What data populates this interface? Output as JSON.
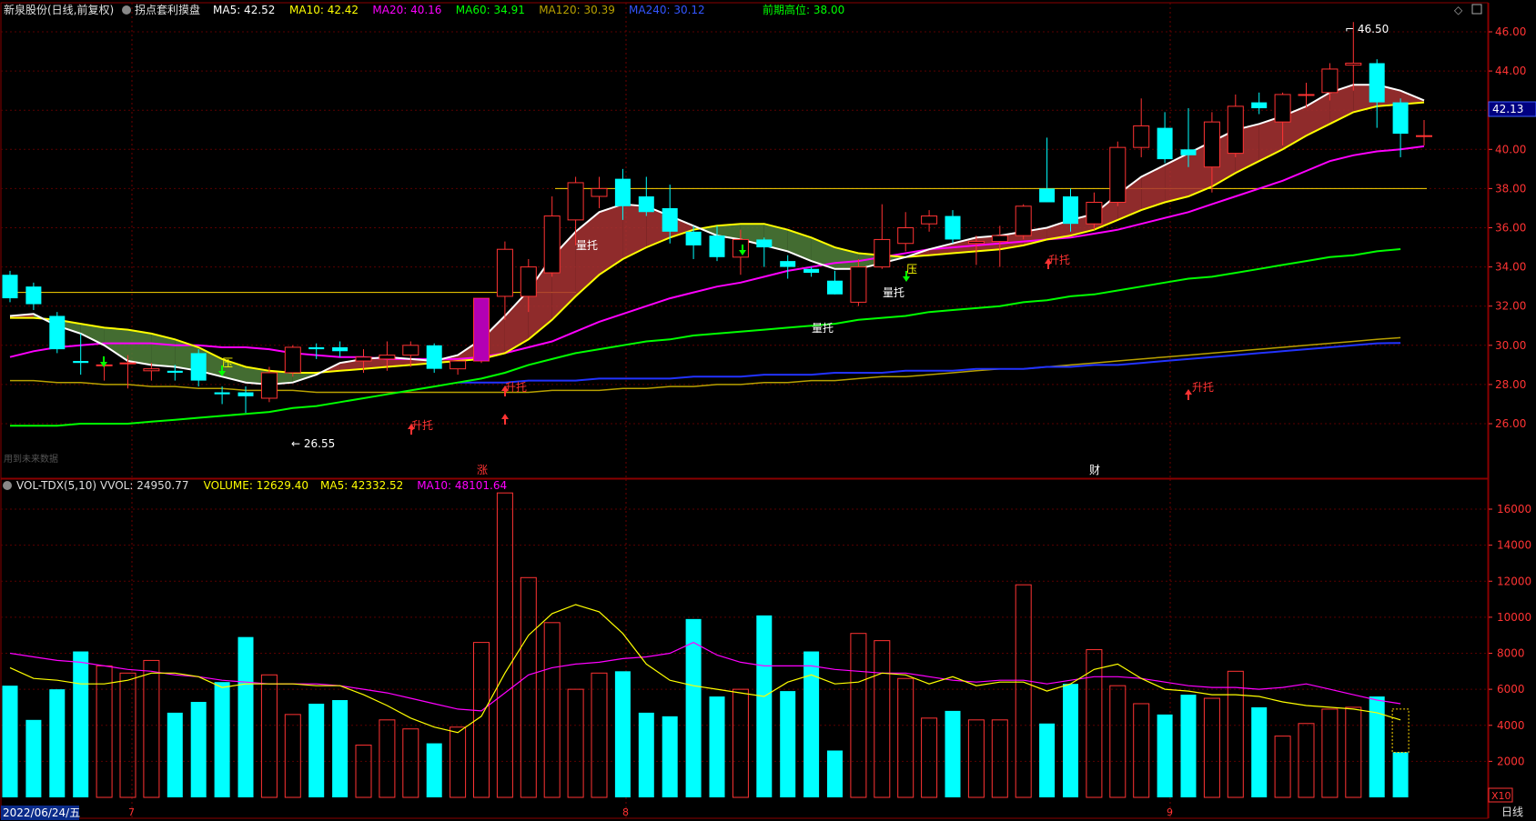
{
  "header": {
    "title": "新泉股份(日线,前复权)",
    "indicator_name": "拐点套利摸盘",
    "ma_items": [
      {
        "label": "MA5: 42.52",
        "color": "#ffffff"
      },
      {
        "label": "MA10: 42.42",
        "color": "#ffff00"
      },
      {
        "label": "MA20: 40.16",
        "color": "#ff00ff"
      },
      {
        "label": "MA60: 34.91",
        "color": "#00ff00"
      },
      {
        "label": "MA120: 30.39",
        "color": "#b8a000"
      },
      {
        "label": "MA240: 30.12",
        "color": "#3355ff"
      }
    ],
    "prev_high_label": "前期高位: 38.00"
  },
  "volume_header": {
    "name": "VOL-TDX(5,10)",
    "items": [
      {
        "label": "VVOL: 24950.77",
        "color": "#dddddd"
      },
      {
        "label": "VOLUME: 12629.40",
        "color": "#ffff00"
      },
      {
        "label": "MA5: 42332.52",
        "color": "#ffff00"
      },
      {
        "label": "MA10: 48101.64",
        "color": "#ff00ff"
      }
    ]
  },
  "price_axis_ticks": [
    "46.00",
    "44.00",
    "42.00",
    "40.00",
    "38.00",
    "36.00",
    "34.00",
    "32.00",
    "30.00",
    "28.00",
    "26.00"
  ],
  "volume_axis_ticks": [
    "16000",
    "14000",
    "12000",
    "10000",
    "8000",
    "6000",
    "4000",
    "2000"
  ],
  "current_price": "42.13",
  "volume_unit": "X10",
  "date_label": "2022/06/24/五",
  "month_labels": [
    "7",
    "8",
    "9"
  ],
  "period_label": "日线",
  "annotations": {
    "high": "46.50",
    "low": "26.55",
    "hold": "量托",
    "press": "压",
    "rise_hold": "升托",
    "surge": "涨",
    "finance": "财",
    "faint": "用到未来数据"
  },
  "colors": {
    "up": "#ff3333",
    "down": "#00ffff",
    "grid": "#5a0000",
    "bg": "#000000"
  },
  "chart_data": {
    "type": "candlestick",
    "candles": [
      {
        "o": 33.6,
        "h": 33.8,
        "l": 32.2,
        "c": 32.4
      },
      {
        "o": 33.0,
        "h": 33.2,
        "l": 31.8,
        "c": 32.1
      },
      {
        "o": 31.5,
        "h": 31.7,
        "l": 29.6,
        "c": 29.8
      },
      {
        "o": 29.2,
        "h": 30.6,
        "l": 28.5,
        "c": 29.1
      },
      {
        "o": 29.0,
        "h": 29.2,
        "l": 28.2,
        "c": 29.0
      },
      {
        "o": 29.1,
        "h": 29.5,
        "l": 27.8,
        "c": 29.1
      },
      {
        "o": 28.7,
        "h": 29.1,
        "l": 28.2,
        "c": 28.8
      },
      {
        "o": 28.7,
        "h": 29.0,
        "l": 28.2,
        "c": 28.6
      },
      {
        "o": 29.6,
        "h": 29.8,
        "l": 27.9,
        "c": 28.2
      },
      {
        "o": 27.6,
        "h": 27.9,
        "l": 27.0,
        "c": 27.5
      },
      {
        "o": 27.6,
        "h": 27.9,
        "l": 26.55,
        "c": 27.4
      },
      {
        "o": 27.3,
        "h": 28.9,
        "l": 27.1,
        "c": 28.6
      },
      {
        "o": 28.6,
        "h": 30.0,
        "l": 28.4,
        "c": 29.9
      },
      {
        "o": 29.9,
        "h": 30.1,
        "l": 29.3,
        "c": 29.8
      },
      {
        "o": 29.9,
        "h": 30.2,
        "l": 29.4,
        "c": 29.7
      },
      {
        "o": 29.2,
        "h": 29.8,
        "l": 28.6,
        "c": 29.4
      },
      {
        "o": 29.3,
        "h": 30.2,
        "l": 28.7,
        "c": 29.5
      },
      {
        "o": 29.5,
        "h": 30.2,
        "l": 28.9,
        "c": 30.0
      },
      {
        "o": 30.0,
        "h": 30.1,
        "l": 28.6,
        "c": 28.8
      },
      {
        "o": 28.8,
        "h": 29.2,
        "l": 28.5,
        "c": 29.2
      },
      {
        "o": 29.2,
        "h": 32.4,
        "l": 29.1,
        "c": 32.4
      },
      {
        "o": 32.5,
        "h": 35.3,
        "l": 31.3,
        "c": 34.9
      },
      {
        "o": 32.5,
        "h": 34.4,
        "l": 31.7,
        "c": 34.0
      },
      {
        "o": 33.7,
        "h": 37.6,
        "l": 33.5,
        "c": 36.6
      },
      {
        "o": 36.4,
        "h": 38.6,
        "l": 35.1,
        "c": 38.3
      },
      {
        "o": 37.6,
        "h": 38.6,
        "l": 37.0,
        "c": 38.0
      },
      {
        "o": 38.5,
        "h": 39.0,
        "l": 36.4,
        "c": 37.1
      },
      {
        "o": 37.6,
        "h": 38.6,
        "l": 36.6,
        "c": 36.8
      },
      {
        "o": 37.0,
        "h": 38.2,
        "l": 35.2,
        "c": 35.8
      },
      {
        "o": 35.8,
        "h": 36.1,
        "l": 34.4,
        "c": 35.1
      },
      {
        "o": 35.6,
        "h": 36.1,
        "l": 34.3,
        "c": 34.5
      },
      {
        "o": 34.5,
        "h": 35.9,
        "l": 33.6,
        "c": 35.4
      },
      {
        "o": 35.4,
        "h": 35.5,
        "l": 34.0,
        "c": 35.0
      },
      {
        "o": 34.3,
        "h": 34.6,
        "l": 33.4,
        "c": 34.0
      },
      {
        "o": 33.9,
        "h": 34.0,
        "l": 33.5,
        "c": 33.7
      },
      {
        "o": 33.3,
        "h": 33.8,
        "l": 32.6,
        "c": 32.6
      },
      {
        "o": 32.2,
        "h": 34.4,
        "l": 32.0,
        "c": 34.0
      },
      {
        "o": 34.0,
        "h": 37.2,
        "l": 33.9,
        "c": 35.4
      },
      {
        "o": 35.2,
        "h": 36.8,
        "l": 34.8,
        "c": 36.0
      },
      {
        "o": 36.2,
        "h": 36.9,
        "l": 35.8,
        "c": 36.6
      },
      {
        "o": 36.6,
        "h": 36.9,
        "l": 35.2,
        "c": 35.4
      },
      {
        "o": 35.2,
        "h": 35.6,
        "l": 34.1,
        "c": 35.3
      },
      {
        "o": 35.3,
        "h": 36.1,
        "l": 34.0,
        "c": 35.6
      },
      {
        "o": 35.6,
        "h": 37.2,
        "l": 35.4,
        "c": 37.1
      },
      {
        "o": 38.0,
        "h": 40.6,
        "l": 37.3,
        "c": 37.3
      },
      {
        "o": 37.6,
        "h": 38.0,
        "l": 35.8,
        "c": 36.2
      },
      {
        "o": 36.2,
        "h": 37.8,
        "l": 35.9,
        "c": 37.3
      },
      {
        "o": 37.3,
        "h": 40.4,
        "l": 37.1,
        "c": 40.1
      },
      {
        "o": 40.1,
        "h": 42.6,
        "l": 39.6,
        "c": 41.2
      },
      {
        "o": 41.1,
        "h": 41.9,
        "l": 39.3,
        "c": 39.5
      },
      {
        "o": 40.0,
        "h": 42.1,
        "l": 39.1,
        "c": 39.7
      },
      {
        "o": 39.1,
        "h": 41.9,
        "l": 37.8,
        "c": 41.4
      },
      {
        "o": 39.8,
        "h": 42.8,
        "l": 39.6,
        "c": 42.2
      },
      {
        "o": 42.4,
        "h": 42.9,
        "l": 41.8,
        "c": 42.1
      },
      {
        "o": 41.4,
        "h": 42.9,
        "l": 40.2,
        "c": 42.8
      },
      {
        "o": 42.8,
        "h": 43.4,
        "l": 42.1,
        "c": 42.8
      },
      {
        "o": 42.9,
        "h": 44.4,
        "l": 42.5,
        "c": 44.1
      },
      {
        "o": 44.3,
        "h": 46.5,
        "l": 43.0,
        "c": 44.4
      },
      {
        "o": 44.4,
        "h": 44.6,
        "l": 41.1,
        "c": 42.4
      },
      {
        "o": 42.4,
        "h": 42.6,
        "l": 39.6,
        "c": 40.8
      },
      {
        "o": 40.7,
        "h": 41.5,
        "l": 40.2,
        "c": 40.7
      }
    ],
    "volume": [
      6200,
      4300,
      6000,
      8100,
      7300,
      6900,
      7600,
      4700,
      5300,
      6400,
      8900,
      6800,
      4600,
      5200,
      5400,
      2900,
      4300,
      3800,
      3000,
      3900,
      8600,
      16900,
      12200,
      9700,
      6000,
      6900,
      7000,
      4700,
      4500,
      9900,
      5600,
      6000,
      10100,
      5900,
      8100,
      2600,
      9100,
      8700,
      6600,
      4400,
      4800,
      4300,
      4300,
      11800,
      4100,
      6300,
      8200,
      6200,
      5200,
      4600,
      5700,
      5500,
      7000,
      5000,
      3400,
      4100,
      4900,
      5000,
      5600,
      2500
    ],
    "ma5": [
      31.5,
      31.6,
      31.0,
      30.6,
      30.0,
      29.2,
      29.0,
      28.9,
      28.7,
      28.4,
      28.1,
      28.0,
      28.1,
      28.5,
      29.1,
      29.3,
      29.4,
      29.3,
      29.2,
      29.5,
      30.3,
      31.5,
      32.8,
      34.5,
      35.8,
      36.8,
      37.2,
      37.1,
      36.6,
      36.1,
      35.6,
      35.4,
      35.1,
      34.8,
      34.3,
      33.9,
      33.9,
      34.2,
      34.5,
      34.9,
      35.2,
      35.5,
      35.6,
      35.8,
      36.0,
      36.4,
      36.7,
      37.7,
      38.6,
      39.2,
      39.8,
      40.4,
      41.0,
      41.3,
      41.7,
      42.2,
      42.9,
      43.3,
      43.3,
      43.0,
      42.5
    ],
    "ma10": [
      31.4,
      31.4,
      31.3,
      31.1,
      30.9,
      30.8,
      30.6,
      30.3,
      29.9,
      29.3,
      28.9,
      28.7,
      28.6,
      28.6,
      28.7,
      28.8,
      28.9,
      29.0,
      29.1,
      29.2,
      29.3,
      29.6,
      30.3,
      31.3,
      32.5,
      33.6,
      34.4,
      35.0,
      35.5,
      35.9,
      36.1,
      36.2,
      36.2,
      35.9,
      35.5,
      35.0,
      34.7,
      34.6,
      34.5,
      34.6,
      34.7,
      34.8,
      34.9,
      35.1,
      35.4,
      35.6,
      35.9,
      36.4,
      36.9,
      37.3,
      37.6,
      38.1,
      38.8,
      39.4,
      40.0,
      40.7,
      41.3,
      41.9,
      42.2,
      42.3,
      42.4
    ],
    "ma20": [
      29.4,
      29.7,
      29.9,
      30.0,
      30.1,
      30.1,
      30.1,
      30.0,
      30.0,
      29.9,
      29.9,
      29.8,
      29.6,
      29.5,
      29.4,
      29.4,
      29.3,
      29.3,
      29.3,
      29.3,
      29.4,
      29.6,
      29.9,
      30.2,
      30.7,
      31.2,
      31.6,
      32.0,
      32.4,
      32.7,
      33.0,
      33.2,
      33.5,
      33.8,
      34.0,
      34.2,
      34.3,
      34.5,
      34.7,
      34.9,
      35.0,
      35.1,
      35.2,
      35.3,
      35.4,
      35.5,
      35.7,
      35.9,
      36.2,
      36.5,
      36.8,
      37.2,
      37.6,
      38.0,
      38.4,
      38.9,
      39.4,
      39.7,
      39.9,
      40.0,
      40.16
    ],
    "ma60": [
      25.9,
      25.9,
      25.9,
      26.0,
      26.0,
      26.0,
      26.1,
      26.2,
      26.3,
      26.4,
      26.5,
      26.6,
      26.8,
      26.9,
      27.1,
      27.3,
      27.5,
      27.7,
      27.9,
      28.1,
      28.3,
      28.6,
      29.0,
      29.3,
      29.6,
      29.8,
      30.0,
      30.2,
      30.3,
      30.5,
      30.6,
      30.7,
      30.8,
      30.9,
      31.0,
      31.1,
      31.3,
      31.4,
      31.5,
      31.7,
      31.8,
      31.9,
      32.0,
      32.2,
      32.3,
      32.5,
      32.6,
      32.8,
      33.0,
      33.2,
      33.4,
      33.5,
      33.7,
      33.9,
      34.1,
      34.3,
      34.5,
      34.6,
      34.8,
      34.91
    ],
    "ma120": [
      28.2,
      28.2,
      28.1,
      28.1,
      28.0,
      28.0,
      27.9,
      27.9,
      27.8,
      27.8,
      27.7,
      27.7,
      27.7,
      27.6,
      27.6,
      27.6,
      27.6,
      27.6,
      27.6,
      27.6,
      27.6,
      27.6,
      27.6,
      27.7,
      27.7,
      27.7,
      27.8,
      27.8,
      27.9,
      27.9,
      28.0,
      28.0,
      28.1,
      28.1,
      28.2,
      28.2,
      28.3,
      28.4,
      28.4,
      28.5,
      28.6,
      28.7,
      28.8,
      28.8,
      28.9,
      29.0,
      29.1,
      29.2,
      29.3,
      29.4,
      29.5,
      29.6,
      29.7,
      29.8,
      29.9,
      30.0,
      30.1,
      30.2,
      30.3,
      30.39
    ],
    "ma240": [
      null,
      null,
      null,
      null,
      null,
      null,
      null,
      null,
      null,
      null,
      null,
      null,
      null,
      null,
      null,
      null,
      null,
      null,
      null,
      28.1,
      28.1,
      28.1,
      28.2,
      28.2,
      28.2,
      28.3,
      28.3,
      28.3,
      28.3,
      28.4,
      28.4,
      28.4,
      28.5,
      28.5,
      28.5,
      28.6,
      28.6,
      28.6,
      28.7,
      28.7,
      28.7,
      28.8,
      28.8,
      28.8,
      28.9,
      28.9,
      29.0,
      29.0,
      29.1,
      29.2,
      29.3,
      29.4,
      29.5,
      29.6,
      29.7,
      29.8,
      29.9,
      30.0,
      30.1,
      30.12
    ],
    "vol_ma5": [
      7200,
      6600,
      6500,
      6300,
      6300,
      6500,
      6900,
      6900,
      6700,
      6100,
      6300,
      6300,
      6300,
      6200,
      6200,
      5700,
      5100,
      4400,
      3900,
      3600,
      4500,
      6900,
      9000,
      10200,
      10700,
      10300,
      9100,
      7400,
      6500,
      6200,
      6000,
      5800,
      5600,
      6400,
      6800,
      6300,
      6400,
      6900,
      6800,
      6300,
      6700,
      6200,
      6400,
      6400,
      5900,
      6300,
      7100,
      7400,
      6600,
      6000,
      5900,
      5700,
      5700,
      5600,
      5300,
      5100,
      5000,
      4900,
      4700,
      4300
    ],
    "vol_ma10": [
      8000,
      7800,
      7600,
      7500,
      7300,
      7100,
      7000,
      6800,
      6700,
      6500,
      6400,
      6300,
      6300,
      6300,
      6200,
      6000,
      5800,
      5500,
      5200,
      4900,
      4800,
      5800,
      6800,
      7200,
      7400,
      7500,
      7700,
      7800,
      8000,
      8600,
      7900,
      7500,
      7300,
      7300,
      7300,
      7100,
      7000,
      6900,
      6900,
      6700,
      6500,
      6400,
      6500,
      6500,
      6300,
      6500,
      6700,
      6700,
      6600,
      6400,
      6200,
      6100,
      6100,
      6000,
      6100,
      6300,
      6000,
      5700,
      5400,
      5200
    ]
  }
}
